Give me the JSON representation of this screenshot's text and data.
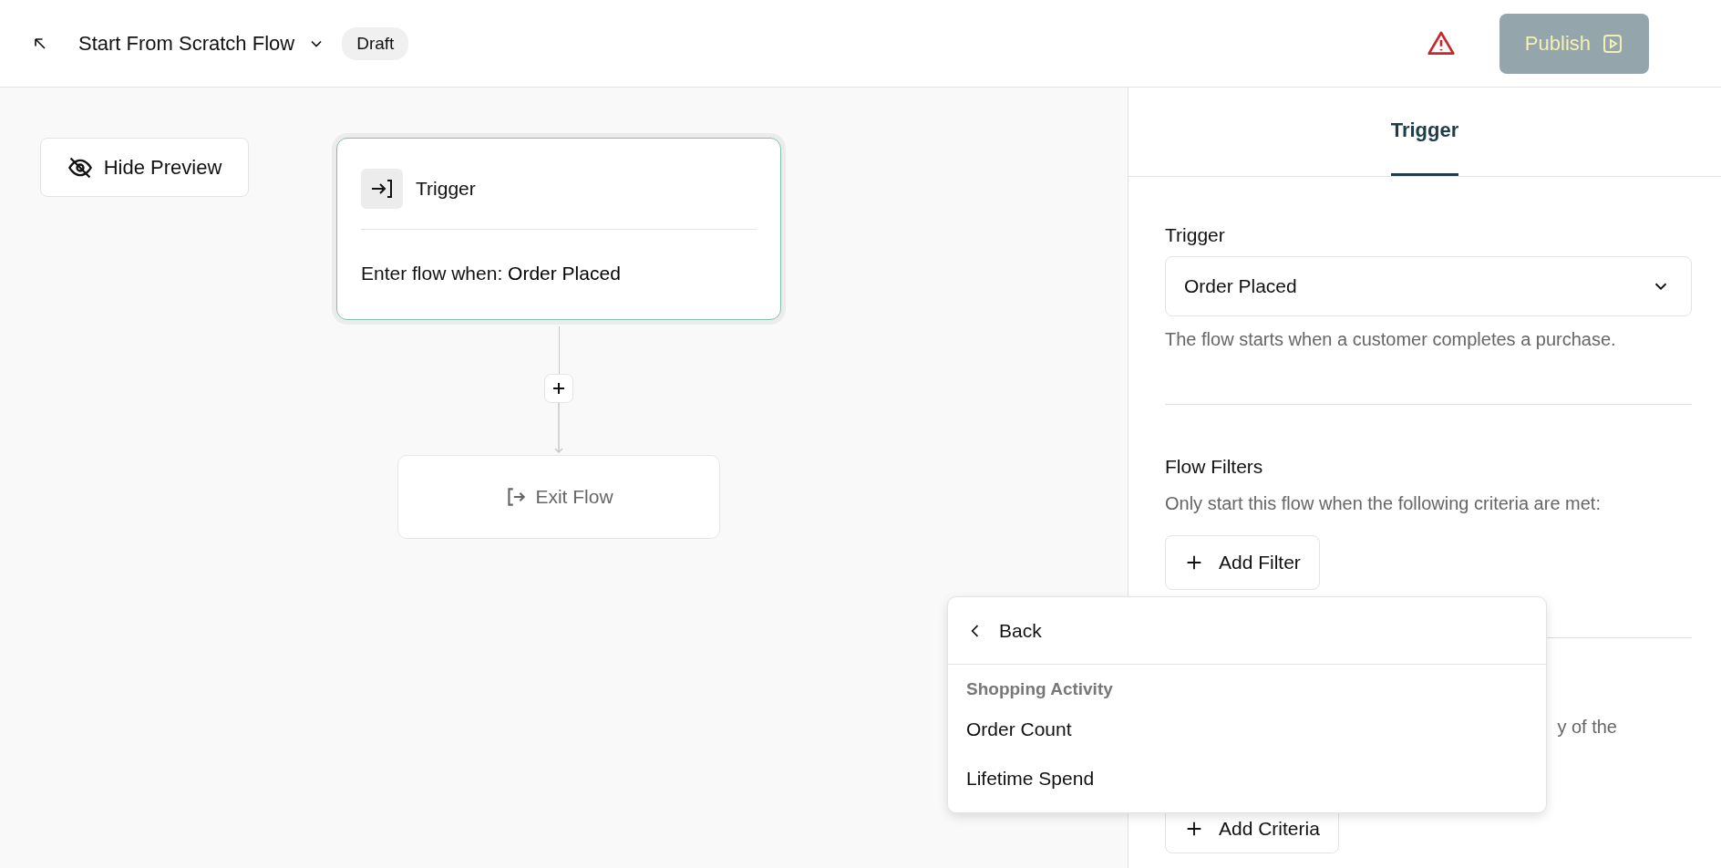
{
  "header": {
    "title": "Start From Scratch Flow",
    "status": "Draft",
    "publish": "Publish",
    "publish_disabled": true,
    "has_warning": true
  },
  "canvas": {
    "hide_preview": "Hide Preview",
    "trigger_node": {
      "title": "Trigger",
      "label": "Enter flow when:",
      "value": "Order Placed",
      "selected": true
    },
    "exit_node": {
      "label": "Exit Flow"
    }
  },
  "panel": {
    "tabs": [
      {
        "label": "Trigger",
        "selected": true
      }
    ],
    "trigger_label": "Trigger",
    "trigger_value": "Order Placed",
    "trigger_help": "The flow starts when a customer completes a purchase.",
    "filters_title": "Flow Filters",
    "filters_help": "Only start this flow when the following criteria are met:",
    "add_filter": "Add Filter",
    "partial_text": "y of the",
    "add_criteria": "Add Criteria"
  },
  "menu": {
    "back": "Back",
    "section": "Shopping Activity",
    "items": [
      {
        "label": "Order Count"
      },
      {
        "label": "Lifetime Spend"
      }
    ]
  }
}
